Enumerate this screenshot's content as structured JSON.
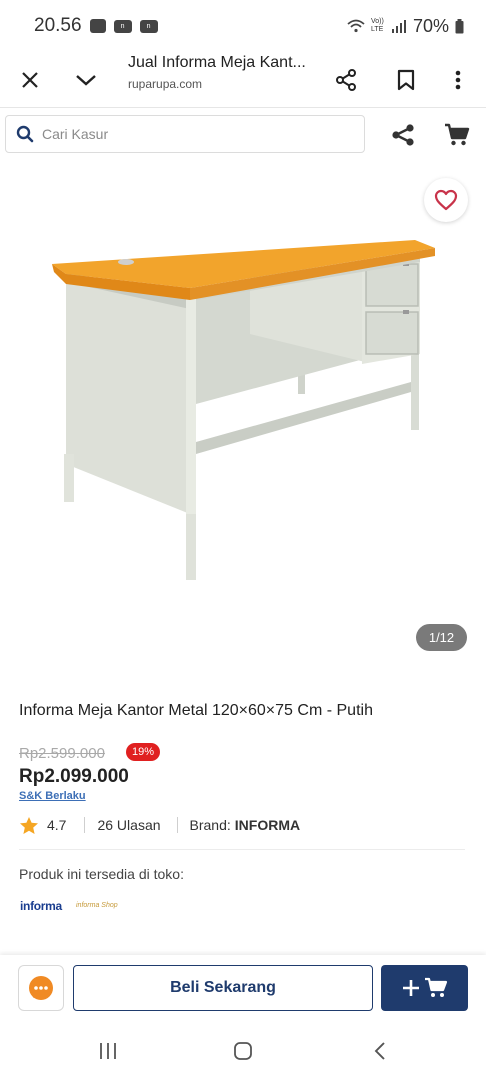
{
  "status_bar": {
    "time": "20.56",
    "icons": [
      "image-icon",
      "notification-icon",
      "notification-icon"
    ],
    "battery": "70%",
    "network": "Vo)) LTE"
  },
  "browser": {
    "title": "Jual Informa Meja Kant...",
    "domain": "ruparupa.com",
    "icons": [
      "close-icon",
      "chevron-down-icon",
      "share-icon",
      "bookmark-icon",
      "more-vert-icon"
    ]
  },
  "search": {
    "placeholder": "Cari Kasur"
  },
  "product": {
    "image_counter": "1/12",
    "title": "Informa Meja Kantor Metal 120×60×75 Cm - Putih",
    "old_price": "Rp2.599.000",
    "discount": "19%",
    "price": "Rp2.099.000",
    "promo": "S&K Berlaku",
    "rating": "4.7",
    "reviews": "26 Ulasan",
    "brand_label": "Brand:",
    "brand": "INFORMA",
    "store_label": "Produk ini tersedia di toko:",
    "stores": [
      "informa",
      "informa Shop"
    ]
  },
  "actions": {
    "buy_now": "Beli Sekarang"
  },
  "colors": {
    "navy": "#1f3b6d",
    "accent_orange": "#f08a24",
    "discount_red": "#e02020",
    "wishlist_red": "#c8334a"
  }
}
